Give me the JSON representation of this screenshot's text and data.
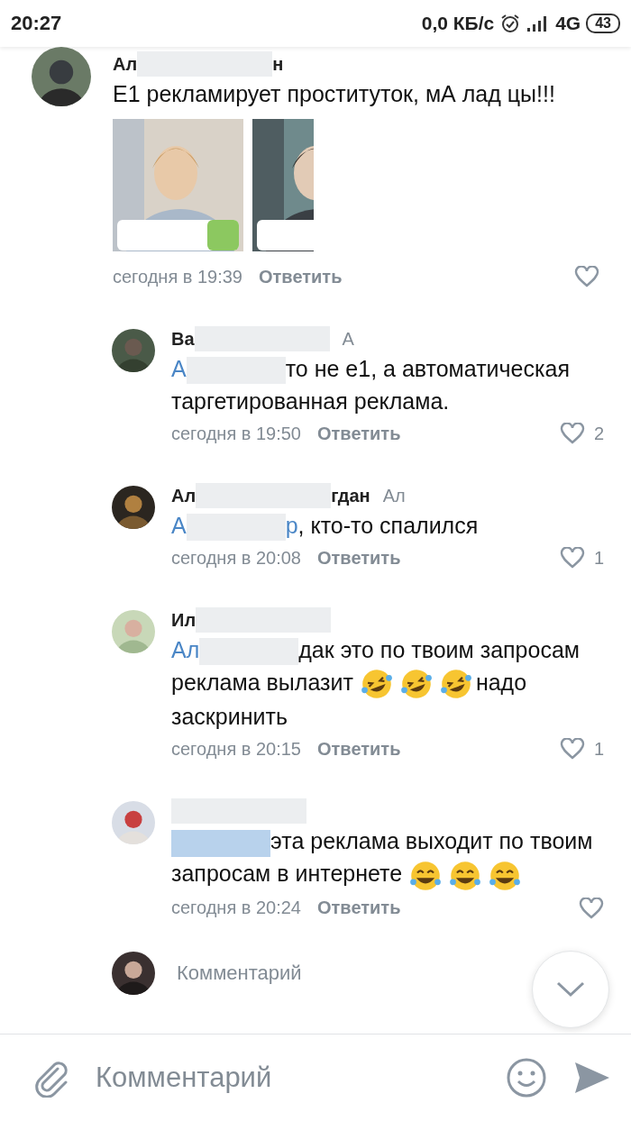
{
  "status_bar": {
    "time": "20:27",
    "speed": "0,0 КБ/с",
    "network": "4G",
    "battery": "43"
  },
  "comments": [
    {
      "name": [
        {
          "kind": "name",
          "text": "Ал"
        },
        {
          "kind": "redacted"
        },
        {
          "kind": "name",
          "text": "н"
        }
      ],
      "body": [
        {
          "kind": "text",
          "text": "Е1 рекламирует проституток, мА лад цы!!!"
        }
      ],
      "attachments": [
        {
          "kind": "picture"
        },
        {
          "kind": "picture"
        }
      ],
      "time": "сегодня в 19:39",
      "reply": "Ответить",
      "liked": false
    },
    {
      "name": [
        {
          "kind": "name",
          "text": "Ва"
        },
        {
          "kind": "redacted"
        },
        {
          "kind": "replyto",
          "text": "А"
        }
      ],
      "body": [
        {
          "kind": "mention",
          "text": "А"
        },
        {
          "kind": "redacted"
        },
        {
          "kind": "text",
          "text": "то не е1, а автоматическая таргетированная реклама."
        }
      ],
      "time": "сегодня в 19:50",
      "reply": "Ответить",
      "liked": false,
      "likes": "2"
    },
    {
      "name": [
        {
          "kind": "name",
          "text": "Ал"
        },
        {
          "kind": "redacted"
        },
        {
          "kind": "name",
          "text": "гдан"
        },
        {
          "kind": "replyto",
          "text": "Ал"
        }
      ],
      "body": [
        {
          "kind": "mention",
          "text": "А"
        },
        {
          "kind": "redacted"
        },
        {
          "kind": "mention",
          "text": "р"
        },
        {
          "kind": "text",
          "text": ", кто-то спалился"
        }
      ],
      "time": "сегодня в 20:08",
      "reply": "Ответить",
      "liked": false,
      "likes": "1"
    },
    {
      "name": [
        {
          "kind": "name",
          "text": "Ил"
        },
        {
          "kind": "redacted"
        }
      ],
      "body": [
        {
          "kind": "mention",
          "text": "Ал"
        },
        {
          "kind": "redacted"
        },
        {
          "kind": "text",
          "text": "дак это по твоим запросам реклама вылазит"
        },
        {
          "kind": "rofl"
        },
        {
          "kind": "rofl"
        },
        {
          "kind": "rofl"
        },
        {
          "kind": "text",
          "text": "надо заскринить"
        }
      ],
      "time": "сегодня в 20:15",
      "reply": "Ответить",
      "liked": false,
      "likes": "1"
    },
    {
      "name": [
        {
          "kind": "redacted"
        }
      ],
      "body": [
        {
          "kind": "redacted"
        },
        {
          "kind": "text",
          "text": "эта реклама выходит по твоим запросам в интернете"
        },
        {
          "kind": "joy"
        },
        {
          "kind": "joy"
        },
        {
          "kind": "joy"
        }
      ],
      "time": "сегодня в 20:24",
      "reply": "Ответить",
      "liked": false
    }
  ],
  "reply_field": {
    "placeholder": "Комментарий"
  },
  "composer": {
    "placeholder": "Комментарий"
  }
}
